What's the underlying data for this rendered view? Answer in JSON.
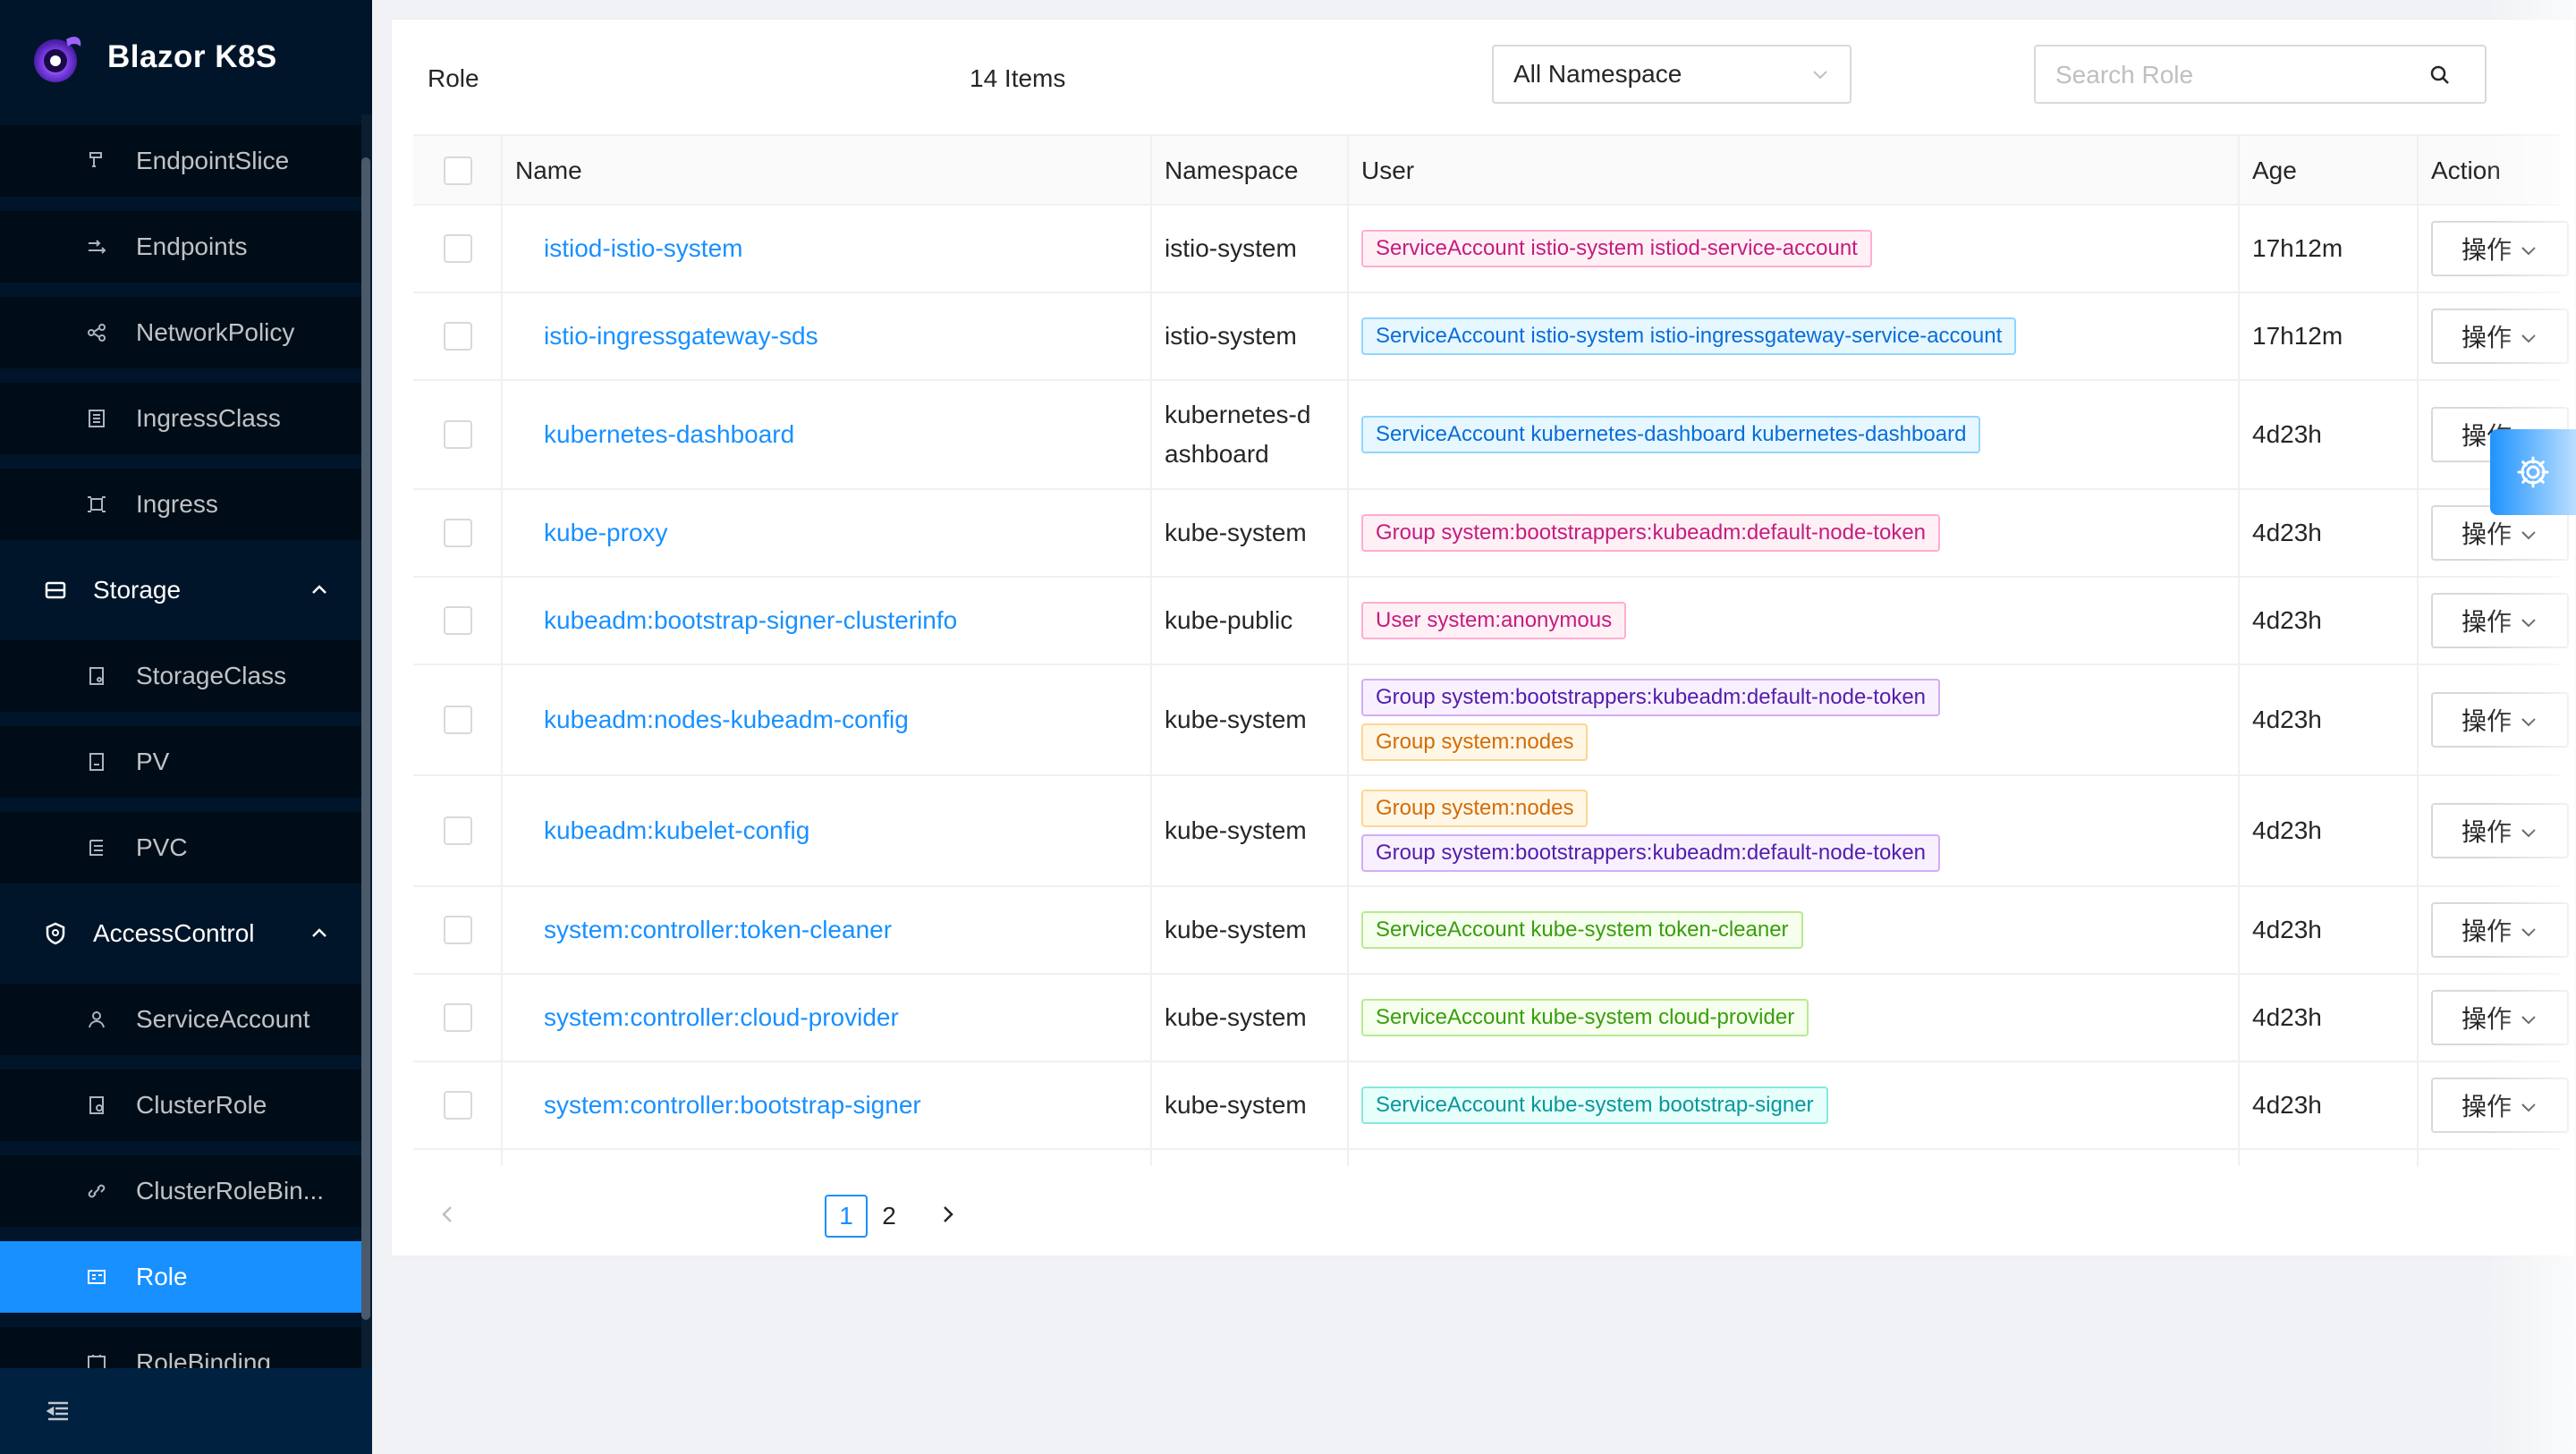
{
  "app": {
    "title": "Blazor K8S"
  },
  "sidebar": {
    "items": [
      {
        "label": "EndpointSlice",
        "icon": "endpoint-slice-icon"
      },
      {
        "label": "Endpoints",
        "icon": "endpoints-icon"
      },
      {
        "label": "NetworkPolicy",
        "icon": "network-policy-icon"
      },
      {
        "label": "IngressClass",
        "icon": "ingress-class-icon"
      },
      {
        "label": "Ingress",
        "icon": "ingress-icon"
      }
    ],
    "storage_group": {
      "label": "Storage",
      "icon": "storage-icon",
      "expanded": true
    },
    "storage_items": [
      {
        "label": "StorageClass",
        "icon": "storage-class-icon"
      },
      {
        "label": "PV",
        "icon": "pv-icon"
      },
      {
        "label": "PVC",
        "icon": "pvc-icon"
      }
    ],
    "access_group": {
      "label": "AccessControl",
      "icon": "access-control-icon",
      "expanded": true
    },
    "access_items": [
      {
        "label": "ServiceAccount",
        "icon": "service-account-icon"
      },
      {
        "label": "ClusterRole",
        "icon": "cluster-role-icon"
      },
      {
        "label": "ClusterRoleBin...",
        "icon": "cluster-role-binding-icon"
      },
      {
        "label": "Role",
        "icon": "role-icon",
        "active": true
      },
      {
        "label": "RoleBinding",
        "icon": "role-binding-icon"
      }
    ]
  },
  "header": {
    "title": "Role",
    "count": "14 Items",
    "namespace_select": "All Namespace",
    "search_placeholder": "Search Role"
  },
  "table": {
    "columns": [
      "Name",
      "Namespace",
      "User",
      "Age",
      "Action"
    ],
    "rows": [
      {
        "name": "istiod-istio-system",
        "namespace": "istio-system",
        "tags": [
          {
            "text": "ServiceAccount istio-system istiod-service-account",
            "color": "magenta"
          }
        ],
        "age": "17h12m",
        "action": "操作"
      },
      {
        "name": "istio-ingressgateway-sds",
        "namespace": "istio-system",
        "tags": [
          {
            "text": "ServiceAccount istio-system istio-ingressgateway-service-account",
            "color": "blue"
          }
        ],
        "age": "17h12m",
        "action": "操作"
      },
      {
        "name": "kubernetes-dashboard",
        "namespace_line1": "kubernetes-d",
        "namespace_line2": "ashboard",
        "tags": [
          {
            "text": "ServiceAccount kubernetes-dashboard kubernetes-dashboard",
            "color": "blue"
          }
        ],
        "age": "4d23h",
        "action": "操作"
      },
      {
        "name": "kube-proxy",
        "namespace": "kube-system",
        "tags": [
          {
            "text": "Group system:bootstrappers:kubeadm:default-node-token",
            "color": "magenta"
          }
        ],
        "age": "4d23h",
        "action": "操作"
      },
      {
        "name": "kubeadm:bootstrap-signer-clusterinfo",
        "namespace": "kube-public",
        "tags": [
          {
            "text": "User system:anonymous",
            "color": "magenta"
          }
        ],
        "age": "4d23h",
        "action": "操作"
      },
      {
        "name": "kubeadm:nodes-kubeadm-config",
        "namespace": "kube-system",
        "tags": [
          {
            "text": "Group system:bootstrappers:kubeadm:default-node-token",
            "color": "purple"
          },
          {
            "text": "Group system:nodes",
            "color": "orange"
          }
        ],
        "age": "4d23h",
        "action": "操作"
      },
      {
        "name": "kubeadm:kubelet-config",
        "namespace": "kube-system",
        "tags": [
          {
            "text": "Group system:nodes",
            "color": "orange"
          },
          {
            "text": "Group system:bootstrappers:kubeadm:default-node-token",
            "color": "purple"
          }
        ],
        "age": "4d23h",
        "action": "操作"
      },
      {
        "name": "system:controller:token-cleaner",
        "namespace": "kube-system",
        "tags": [
          {
            "text": "ServiceAccount kube-system token-cleaner",
            "color": "green"
          }
        ],
        "age": "4d23h",
        "action": "操作"
      },
      {
        "name": "system:controller:cloud-provider",
        "namespace": "kube-system",
        "tags": [
          {
            "text": "ServiceAccount kube-system cloud-provider",
            "color": "green"
          }
        ],
        "age": "4d23h",
        "action": "操作"
      },
      {
        "name": "system:controller:bootstrap-signer",
        "namespace": "kube-system",
        "tags": [
          {
            "text": "ServiceAccount kube-system bootstrap-signer",
            "color": "cyan"
          }
        ],
        "age": "4d23h",
        "action": "操作"
      }
    ]
  },
  "pagination": {
    "pages": [
      "1",
      "2"
    ],
    "current": "1"
  },
  "colors": {
    "primary": "#1890ff",
    "sidebar_bg": "#001529",
    "submenu_bg": "#000c17"
  }
}
